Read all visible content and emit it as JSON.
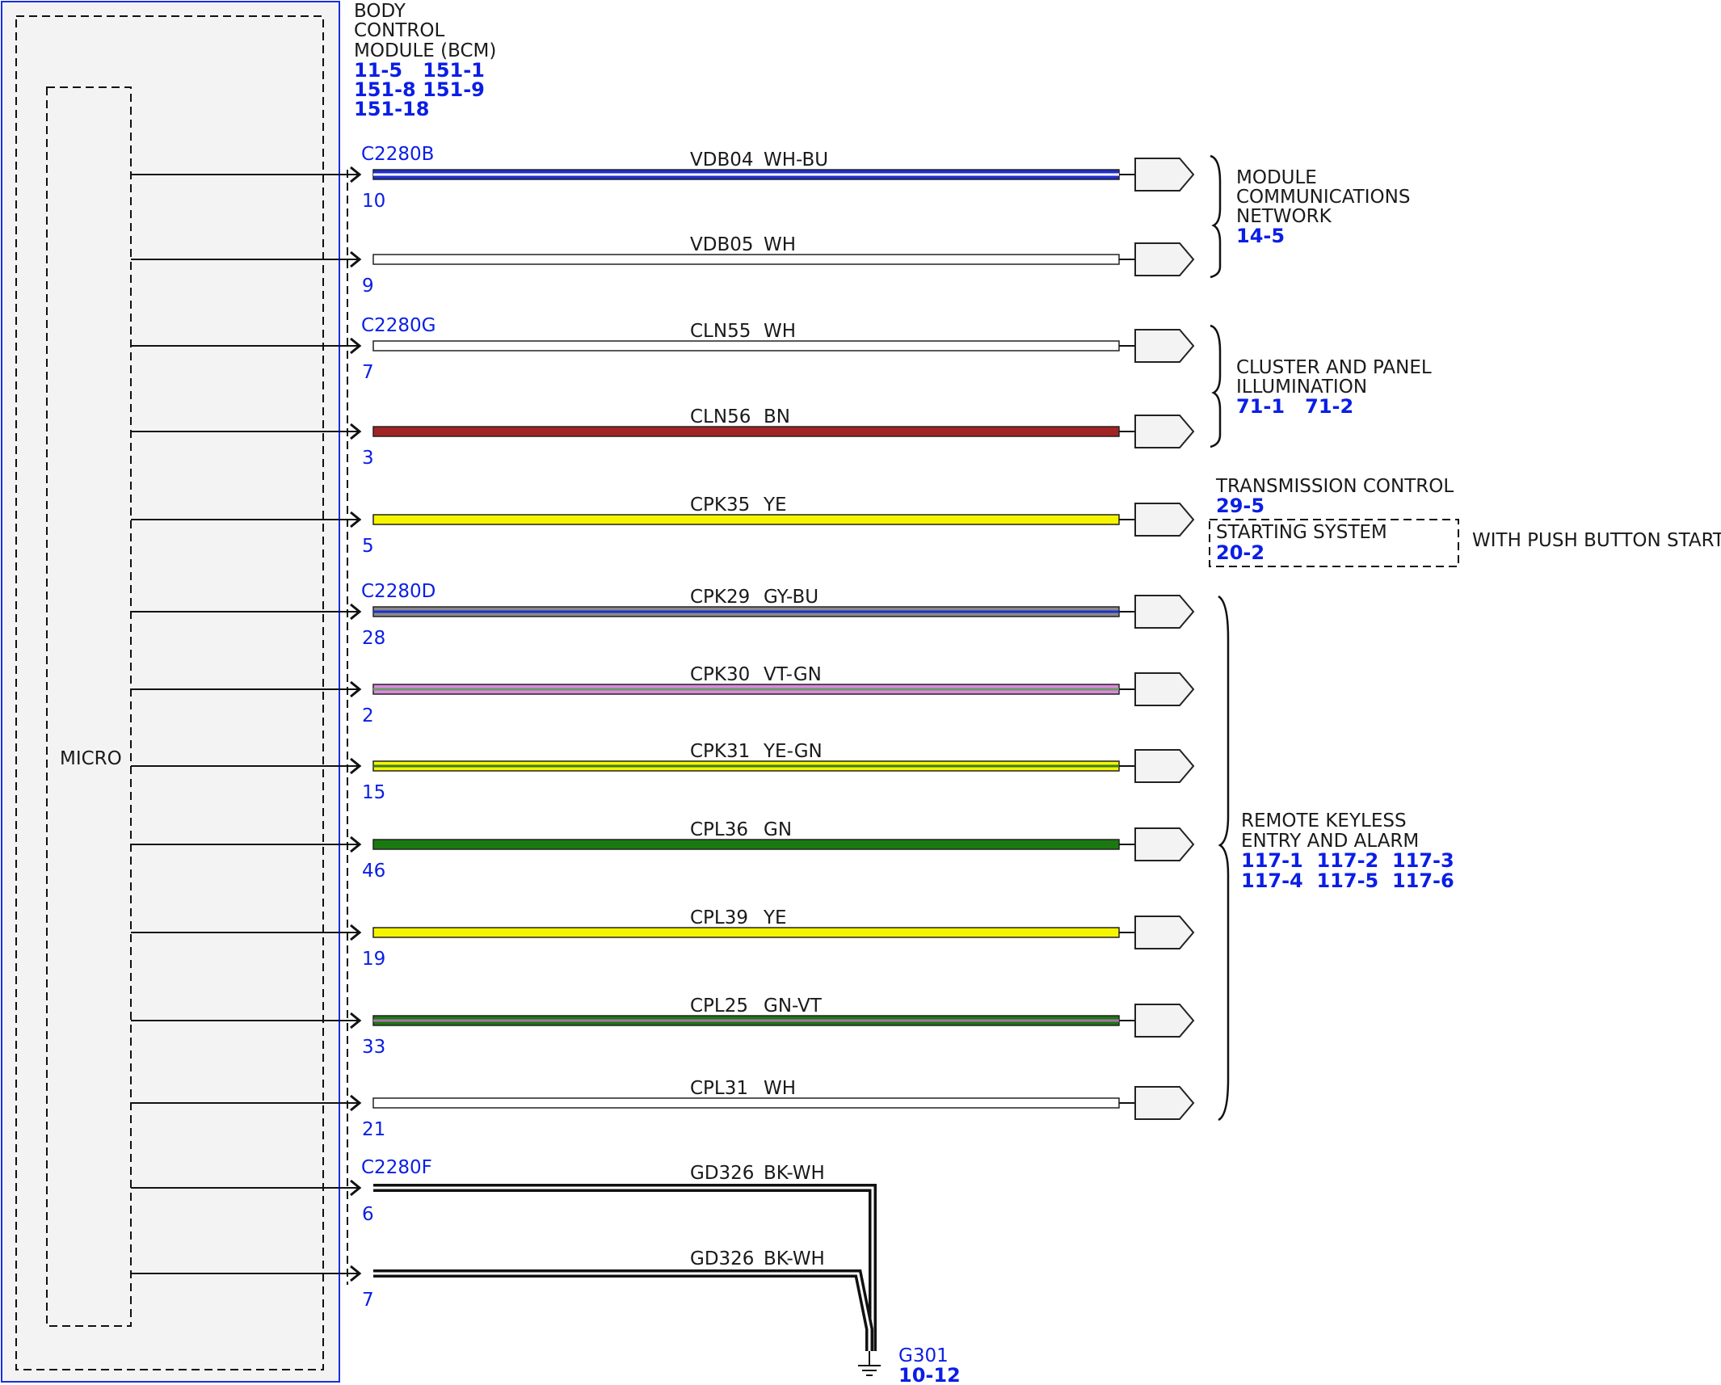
{
  "module": {
    "name_lines": [
      "BODY",
      "CONTROL",
      "MODULE (BCM)"
    ],
    "ref_lines": [
      "11-5   151-1",
      "151-8 151-9",
      "151-18"
    ],
    "micro_label": "MICRO"
  },
  "wires": [
    {
      "connector": "C2280B",
      "pin": "10",
      "circuit": "VDB04",
      "color": "WH-BU",
      "fill": "#1f2fd0",
      "stripe": "#ffffff",
      "heavy": false
    },
    {
      "connector": "",
      "pin": "9",
      "circuit": "VDB05",
      "color": "WH",
      "fill": "#ffffff",
      "stripe": "",
      "heavy": false
    },
    {
      "connector": "C2280G",
      "pin": "7",
      "circuit": "CLN55",
      "color": "WH",
      "fill": "#ffffff",
      "stripe": "",
      "heavy": false
    },
    {
      "connector": "",
      "pin": "3",
      "circuit": "CLN56",
      "color": "BN",
      "fill": "#a32424",
      "stripe": "",
      "heavy": false
    },
    {
      "connector": "",
      "pin": "5",
      "circuit": "CPK35",
      "color": "YE",
      "fill": "#f5f500",
      "stripe": "",
      "heavy": false
    },
    {
      "connector": "C2280D",
      "pin": "28",
      "circuit": "CPK29",
      "color": "GY-BU",
      "fill": "#8a8a8a",
      "stripe": "#1f2fd0",
      "heavy": false
    },
    {
      "connector": "",
      "pin": "2",
      "circuit": "CPK30",
      "color": "VT-GN",
      "fill": "#dd88dd",
      "stripe": "#6a9a6a",
      "heavy": false
    },
    {
      "connector": "",
      "pin": "15",
      "circuit": "CPK31",
      "color": "YE-GN",
      "fill": "#f5f500",
      "stripe": "#3a7a1a",
      "heavy": false
    },
    {
      "connector": "",
      "pin": "46",
      "circuit": "CPL36",
      "color": "GN",
      "fill": "#1a7a10",
      "stripe": "",
      "heavy": false
    },
    {
      "connector": "",
      "pin": "19",
      "circuit": "CPL39",
      "color": "YE",
      "fill": "#f5f500",
      "stripe": "",
      "heavy": false
    },
    {
      "connector": "",
      "pin": "33",
      "circuit": "CPL25",
      "color": "GN-VT",
      "fill": "#1a7a10",
      "stripe": "#b070b0",
      "heavy": false
    },
    {
      "connector": "",
      "pin": "21",
      "circuit": "CPL31",
      "color": "WH",
      "fill": "#ffffff",
      "stripe": "",
      "heavy": false
    },
    {
      "connector": "C2280F",
      "pin": "6",
      "circuit": "GD326",
      "color": "BK-WH",
      "fill": "#ffffff",
      "stripe": "",
      "heavy": true
    },
    {
      "connector": "",
      "pin": "7",
      "circuit": "GD326",
      "color": "BK-WH",
      "fill": "#ffffff",
      "stripe": "",
      "heavy": true
    }
  ],
  "destinations": [
    {
      "label_lines": [
        "MODULE",
        "COMMUNICATIONS",
        "NETWORK"
      ],
      "refs": "14-5"
    },
    {
      "label_lines": [
        "CLUSTER AND PANEL",
        "ILLUMINATION"
      ],
      "refs": "71-1   71-2"
    },
    {
      "label_lines": [
        "TRANSMISSION CONTROL"
      ],
      "refs": "29-5"
    },
    {
      "label_lines": [
        "STARTING SYSTEM"
      ],
      "refs": "20-2"
    },
    {
      "label_lines": [
        "REMOTE KEYLESS",
        "ENTRY AND ALARM"
      ],
      "refs": "117-1  117-2  117-3",
      "refs2": "117-4  117-5  117-6"
    }
  ],
  "option_note": "WITH PUSH BUTTON START",
  "ground": {
    "name": "G301",
    "ref": "10-12"
  },
  "colors": {
    "module_border": "#1a2ee0",
    "module_fill": "#f3f3f3",
    "connector_text": "#0a1ee6"
  }
}
